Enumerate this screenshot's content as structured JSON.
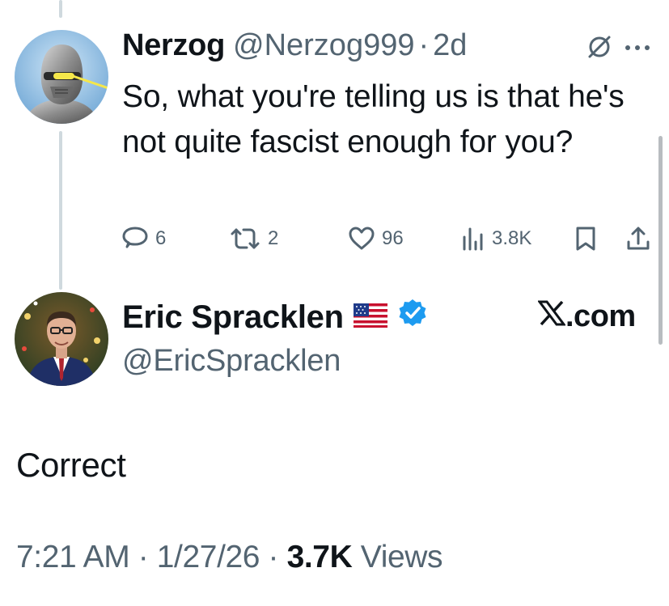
{
  "reply": {
    "name": "Nerzog",
    "handle": "@Nerzog999",
    "separator": "·",
    "time": "2d",
    "text": "So, what you're telling us is that he's not quite fascist enough for you?",
    "icons": [
      "grok-icon",
      "more-icon"
    ],
    "actions": {
      "replies": "6",
      "reposts": "2",
      "likes": "96",
      "views": "3.8K"
    }
  },
  "tweet": {
    "name": "Eric Spracklen",
    "handle": "@EricSpracklen",
    "badge_icons": [
      "us-flag-icon",
      "verified-badge-icon"
    ],
    "site_label": ".com",
    "text": "Correct",
    "time": "7:21 AM",
    "date": "1/27/26",
    "separator": "·",
    "views_count": "3.7K",
    "views_label": "Views"
  },
  "colors": {
    "text": "#0f1419",
    "secondary": "#536471",
    "verified": "#1d9bf0",
    "thread_line": "#cfd9de"
  }
}
